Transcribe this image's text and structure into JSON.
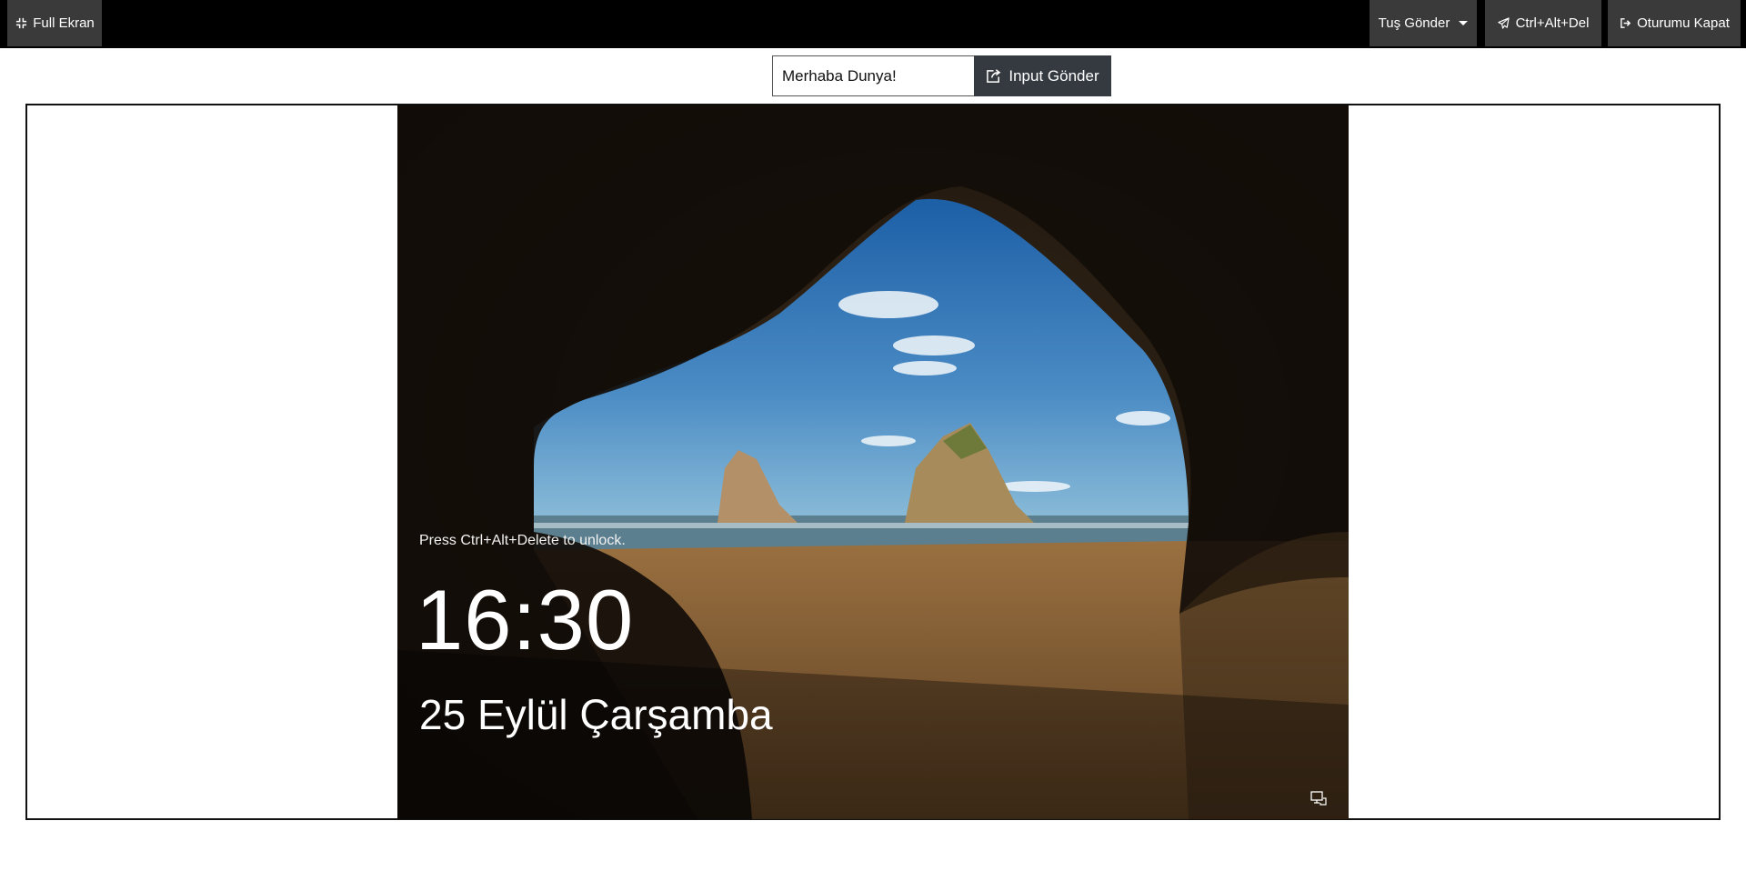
{
  "toolbar": {
    "fullscreen_label": "Full Ekran",
    "send_keys_label": "Tuş Gönder",
    "ctrl_alt_del_label": "Ctrl+Alt+Del",
    "logout_label": "Oturumu Kapat"
  },
  "input_bar": {
    "value": "Merhaba Dunya!",
    "send_label": "Input Gönder"
  },
  "lockscreen": {
    "unlock_hint": "Press Ctrl+Alt+Delete to unlock.",
    "time": "16:30",
    "date": "25 Eylül Çarşamba"
  },
  "icons": {
    "fullscreen": "compress-icon",
    "send_keys": "caret-down-icon",
    "ctrl_alt_del": "paper-plane-icon",
    "logout": "sign-out-icon",
    "send_input": "share-square-icon",
    "network": "network-monitor-icon"
  },
  "colors": {
    "topbar_bg": "#000000",
    "button_bg": "#3a3a3a",
    "send_button_bg": "#343a40"
  }
}
